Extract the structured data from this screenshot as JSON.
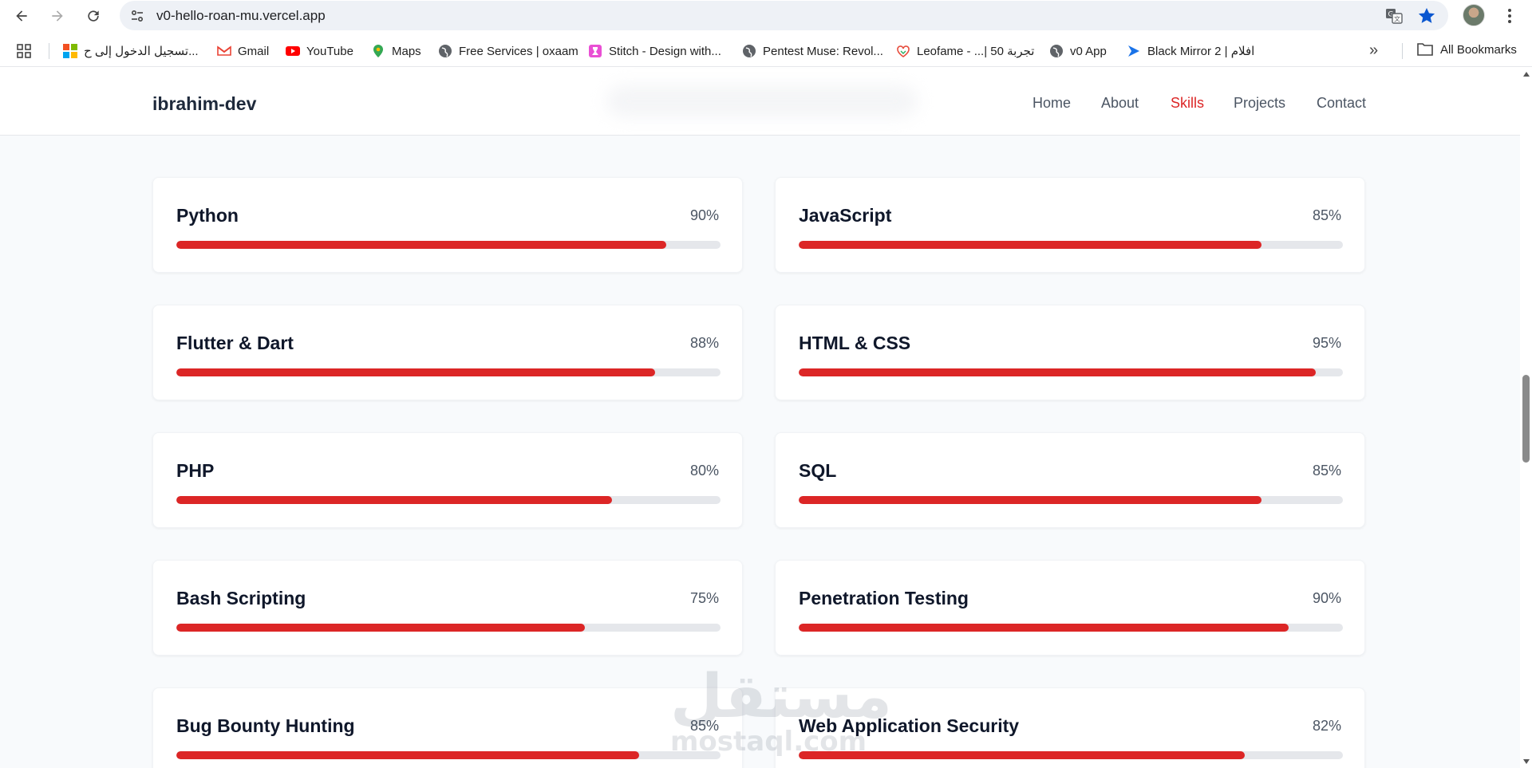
{
  "browser": {
    "url": "v0-hello-roan-mu.vercel.app",
    "bookmarks": [
      {
        "label": "تسجيل الدخول إلى ح...",
        "icon": "microsoft-icon"
      },
      {
        "label": "Gmail",
        "icon": "gmail-icon"
      },
      {
        "label": "YouTube",
        "icon": "youtube-icon"
      },
      {
        "label": "Maps",
        "icon": "maps-icon"
      },
      {
        "label": "Free Services | oxaam",
        "icon": "globe-icon"
      },
      {
        "label": "Stitch - Design with...",
        "icon": "stitch-icon"
      },
      {
        "label": "Pentest Muse: Revol...",
        "icon": "globe-icon"
      },
      {
        "label": "Leofame - ...| تجربة 50",
        "icon": "leofame-icon"
      },
      {
        "label": "v0 App",
        "icon": "globe-icon"
      },
      {
        "label": "Black Mirror 2 | افلام",
        "icon": "arrow-icon"
      }
    ],
    "all_bookmarks_label": "All Bookmarks",
    "overflow_label": "»"
  },
  "site": {
    "logo": "ibrahim-dev",
    "nav": [
      {
        "label": "Home",
        "active": false
      },
      {
        "label": "About",
        "active": false
      },
      {
        "label": "Skills",
        "active": true
      },
      {
        "label": "Projects",
        "active": false
      },
      {
        "label": "Contact",
        "active": false
      }
    ],
    "accent_color": "#dc2626"
  },
  "skills": [
    {
      "name": "Python",
      "percent_label": "90%",
      "level": 0.9
    },
    {
      "name": "JavaScript",
      "percent_label": "85%",
      "level": 0.85
    },
    {
      "name": "Flutter & Dart",
      "percent_label": "88%",
      "level": 0.88
    },
    {
      "name": "HTML & CSS",
      "percent_label": "95%",
      "level": 0.95
    },
    {
      "name": "PHP",
      "percent_label": "80%",
      "level": 0.8
    },
    {
      "name": "SQL",
      "percent_label": "85%",
      "level": 0.85
    },
    {
      "name": "Bash Scripting",
      "percent_label": "75%",
      "level": 0.75
    },
    {
      "name": "Penetration Testing",
      "percent_label": "90%",
      "level": 0.9
    },
    {
      "name": "Bug Bounty Hunting",
      "percent_label": "85%",
      "level": 0.85
    },
    {
      "name": "Web Application Security",
      "percent_label": "82%",
      "level": 0.82
    }
  ],
  "watermark": {
    "text_ar": "مستقل",
    "text_en": "mostaql.com"
  }
}
